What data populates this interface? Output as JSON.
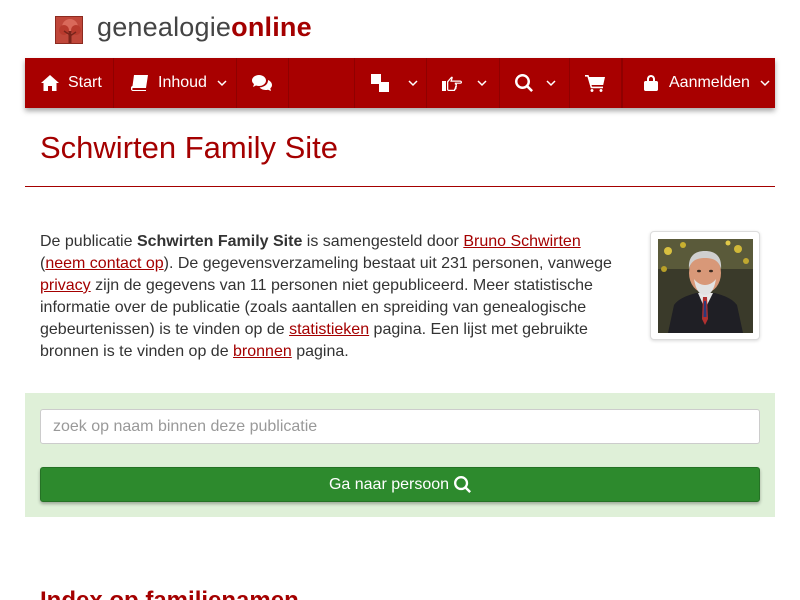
{
  "brand": {
    "name_part1": "genealogie",
    "name_part2": "online",
    "logo_icon": "tree-icon",
    "accent_color": "#a40000"
  },
  "nav": {
    "items": [
      {
        "id": "start",
        "icon": "home-icon",
        "label": "Start",
        "dropdown": false
      },
      {
        "id": "inhoud",
        "icon": "book-icon",
        "label": "Inhoud",
        "dropdown": true
      },
      {
        "id": "chat",
        "icon": "comments-icon",
        "label": "",
        "dropdown": false
      },
      {
        "id": "language",
        "icon": "language-icon",
        "label": "",
        "dropdown": true
      },
      {
        "id": "share",
        "icon": "hand-point-icon",
        "label": "",
        "dropdown": true
      },
      {
        "id": "search",
        "icon": "search-icon",
        "label": "",
        "dropdown": true
      },
      {
        "id": "shop",
        "icon": "shopping-cart-icon",
        "label": "",
        "dropdown": false
      },
      {
        "id": "login",
        "icon": "lock-icon",
        "label": "Aanmelden",
        "dropdown": true
      }
    ],
    "background_color": "#a80000"
  },
  "page": {
    "title": "Schwirten Family Site"
  },
  "intro": {
    "text1": "De publicatie ",
    "publication_name": "Schwirten Family Site",
    "text2": " is samengesteld door ",
    "author_link": "Bruno Schwirten",
    "text3": " (",
    "contact_link": "neem contact op",
    "text4": "). De gegevensverzameling bestaat uit 231 personen, vanwege ",
    "privacy_link": "privacy",
    "text5": " zijn de gegevens van 11 personen niet gepubliceerd. Meer statistische informatie over de publicatie (zoals aantallen en spreiding van genealogische gebeurtenissen) is te vinden op de ",
    "stats_link": "statistieken",
    "text6": " pagina. Een lijst met gebruikte bronnen is te vinden op de ",
    "sources_link": "bronnen",
    "text7": " pagina."
  },
  "search": {
    "placeholder": "zoek op naam binnen deze publicatie",
    "value": "",
    "button_label": "Ga naar persoon",
    "button_icon": "search-icon",
    "panel_color": "#dff0d8",
    "button_color": "#2d8a2d"
  },
  "index": {
    "heading": "Index op familienamen"
  }
}
